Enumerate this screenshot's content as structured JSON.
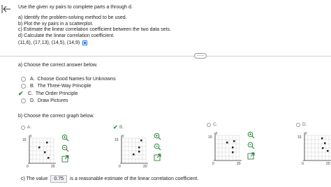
{
  "problem": {
    "intro": "Use the given xy pairs to complete parts a through d.",
    "parts": [
      "a) Identify the problem-solving method to be used.",
      "b) Plot the xy pairs in a scatterplot.",
      "c) Estimate the linear correlation coefficient between the two data sets.",
      "d) Calculate the linear correlation coefficient."
    ],
    "pairs": "(11,6), (17,13), (14,5), (14,9)"
  },
  "divider": {
    "more_label": "....."
  },
  "part_a": {
    "prompt": "a) Choose the correct answer below.",
    "options": [
      {
        "letter": "A.",
        "text": "Choose Good Names for Unknowns",
        "selected": false
      },
      {
        "letter": "B.",
        "text": "The Three-Way Principle",
        "selected": false
      },
      {
        "letter": "C.",
        "text": "The Order Principle",
        "selected": true
      },
      {
        "letter": "D.",
        "text": "Draw Pictures",
        "selected": false
      }
    ]
  },
  "part_b": {
    "prompt": "b) Choose the correct graph below.",
    "graphs": [
      {
        "letter": "A.",
        "selected": false,
        "y_axis_label": "y",
        "y_tick": "15",
        "x_tick": "20",
        "origin": "0"
      },
      {
        "letter": "B.",
        "selected": true,
        "y_axis_label": "y",
        "y_tick": "15",
        "x_tick": "20",
        "origin": "0"
      },
      {
        "letter": "C.",
        "selected": false,
        "y_axis_label": "y",
        "y_tick": "15",
        "x_tick": "20",
        "origin": "0"
      },
      {
        "letter": "D.",
        "selected": false,
        "y_axis_label": "y",
        "y_tick": "15",
        "x_tick": "20",
        "origin": "0"
      }
    ]
  },
  "part_c": {
    "prefix": "c) The value",
    "value": "0.75",
    "suffix": "is a reasonable estimate of the linear correlation coefficient."
  },
  "colors": {
    "accent": "#2f6fd0",
    "check": "#2a8f3a",
    "zoom": "#2f7d3a"
  }
}
